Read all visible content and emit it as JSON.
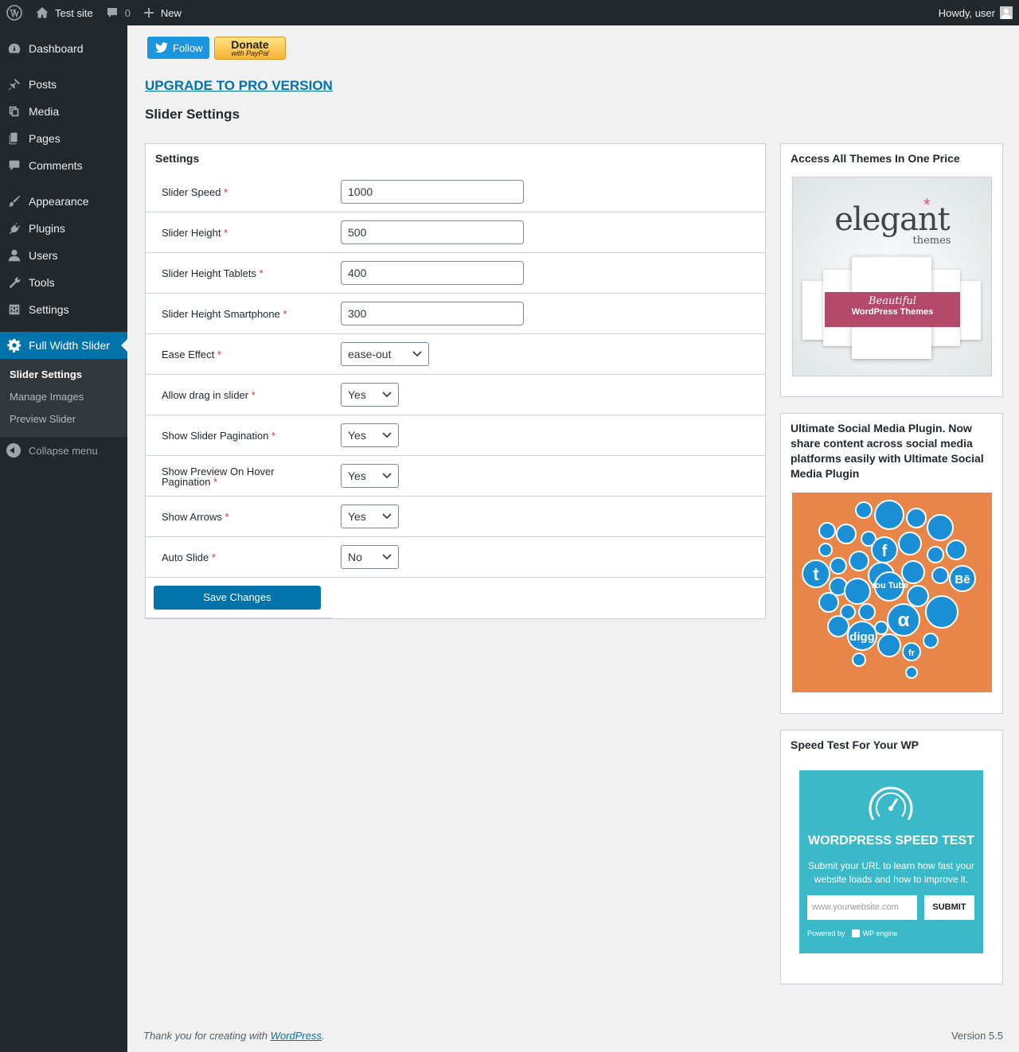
{
  "adminbar": {
    "site_name": "Test site",
    "comments_count": "0",
    "new_label": "New",
    "howdy": "Howdy, user"
  },
  "sidebar": {
    "items": [
      {
        "label": "Dashboard",
        "icon": "dashboard-icon"
      },
      {
        "label": "Posts",
        "icon": "pin-icon"
      },
      {
        "label": "Media",
        "icon": "media-icon"
      },
      {
        "label": "Pages",
        "icon": "pages-icon"
      },
      {
        "label": "Comments",
        "icon": "comment-icon"
      },
      {
        "label": "Appearance",
        "icon": "brush-icon"
      },
      {
        "label": "Plugins",
        "icon": "plugin-icon"
      },
      {
        "label": "Users",
        "icon": "user-icon"
      },
      {
        "label": "Tools",
        "icon": "wrench-icon"
      },
      {
        "label": "Settings",
        "icon": "settings-icon"
      },
      {
        "label": "Full Width Slider",
        "icon": "gear-icon"
      }
    ],
    "submenu": [
      "Slider Settings",
      "Manage Images",
      "Preview Slider"
    ],
    "collapse": "Collapse menu"
  },
  "main": {
    "follow_label": "Follow",
    "donate_label": "Donate",
    "donate_sub": "with PayPal",
    "upgrade_link": "UPGRADE TO PRO VERSION",
    "page_title": "Slider Settings",
    "box_title": "Settings",
    "fields": [
      {
        "label": "Slider Speed",
        "value": "1000"
      },
      {
        "label": "Slider Height",
        "value": "500"
      },
      {
        "label": "Slider Height Tablets",
        "value": "400"
      },
      {
        "label": "Slider Height Smartphone",
        "value": "300"
      },
      {
        "label": "Ease Effect",
        "value": "ease-out"
      },
      {
        "label": "Allow drag in slider",
        "value": "Yes"
      },
      {
        "label": "Show Slider Pagination",
        "value": "Yes"
      },
      {
        "label": "Show Preview On Hover Pagination",
        "value": "Yes"
      },
      {
        "label": "Show Arrows",
        "value": "Yes"
      },
      {
        "label": "Auto Slide",
        "value": "No"
      }
    ],
    "required_mark": "*",
    "save_label": "Save Changes"
  },
  "widgets": {
    "themes_title": "Access All Themes In One Price",
    "themes_ad": {
      "brand": "elegant",
      "brand_sub": "themes",
      "ribbon1": "Beautiful",
      "ribbon2": "WordPress Themes"
    },
    "social_title": "Ultimate Social Media Plugin. Now share content across social media platforms easily with Ultimate Social Media Plugin",
    "social_ad": {
      "youtube_label": "You Tube",
      "digg_label": "digg",
      "behance_label": "Bē",
      "tumblr_label": "t",
      "fb_label": "f",
      "fr_label": "fr"
    },
    "speed_title": "Speed Test For Your WP",
    "speed_ad": {
      "headline": "WORDPRESS SPEED TEST",
      "body": "Submit your URL to learn how fast your website loads and how to improve it.",
      "placeholder": "www.yourwebsite.com",
      "submit": "SUBMIT",
      "powered": "Powered by",
      "powered_brand": "WP engine"
    }
  },
  "footer": {
    "thanks_prefix": "Thank you for creating with ",
    "thanks_link": "WordPress",
    "thanks_suffix": ".",
    "version": "Version 5.5"
  },
  "colors": {
    "accent": "#0073aa",
    "adminbar_bg": "#23282d",
    "required": "#dc3232",
    "twitter": "#1b95e0",
    "speed_bg": "#3bb9c8",
    "social_bg": "#e8864a"
  }
}
